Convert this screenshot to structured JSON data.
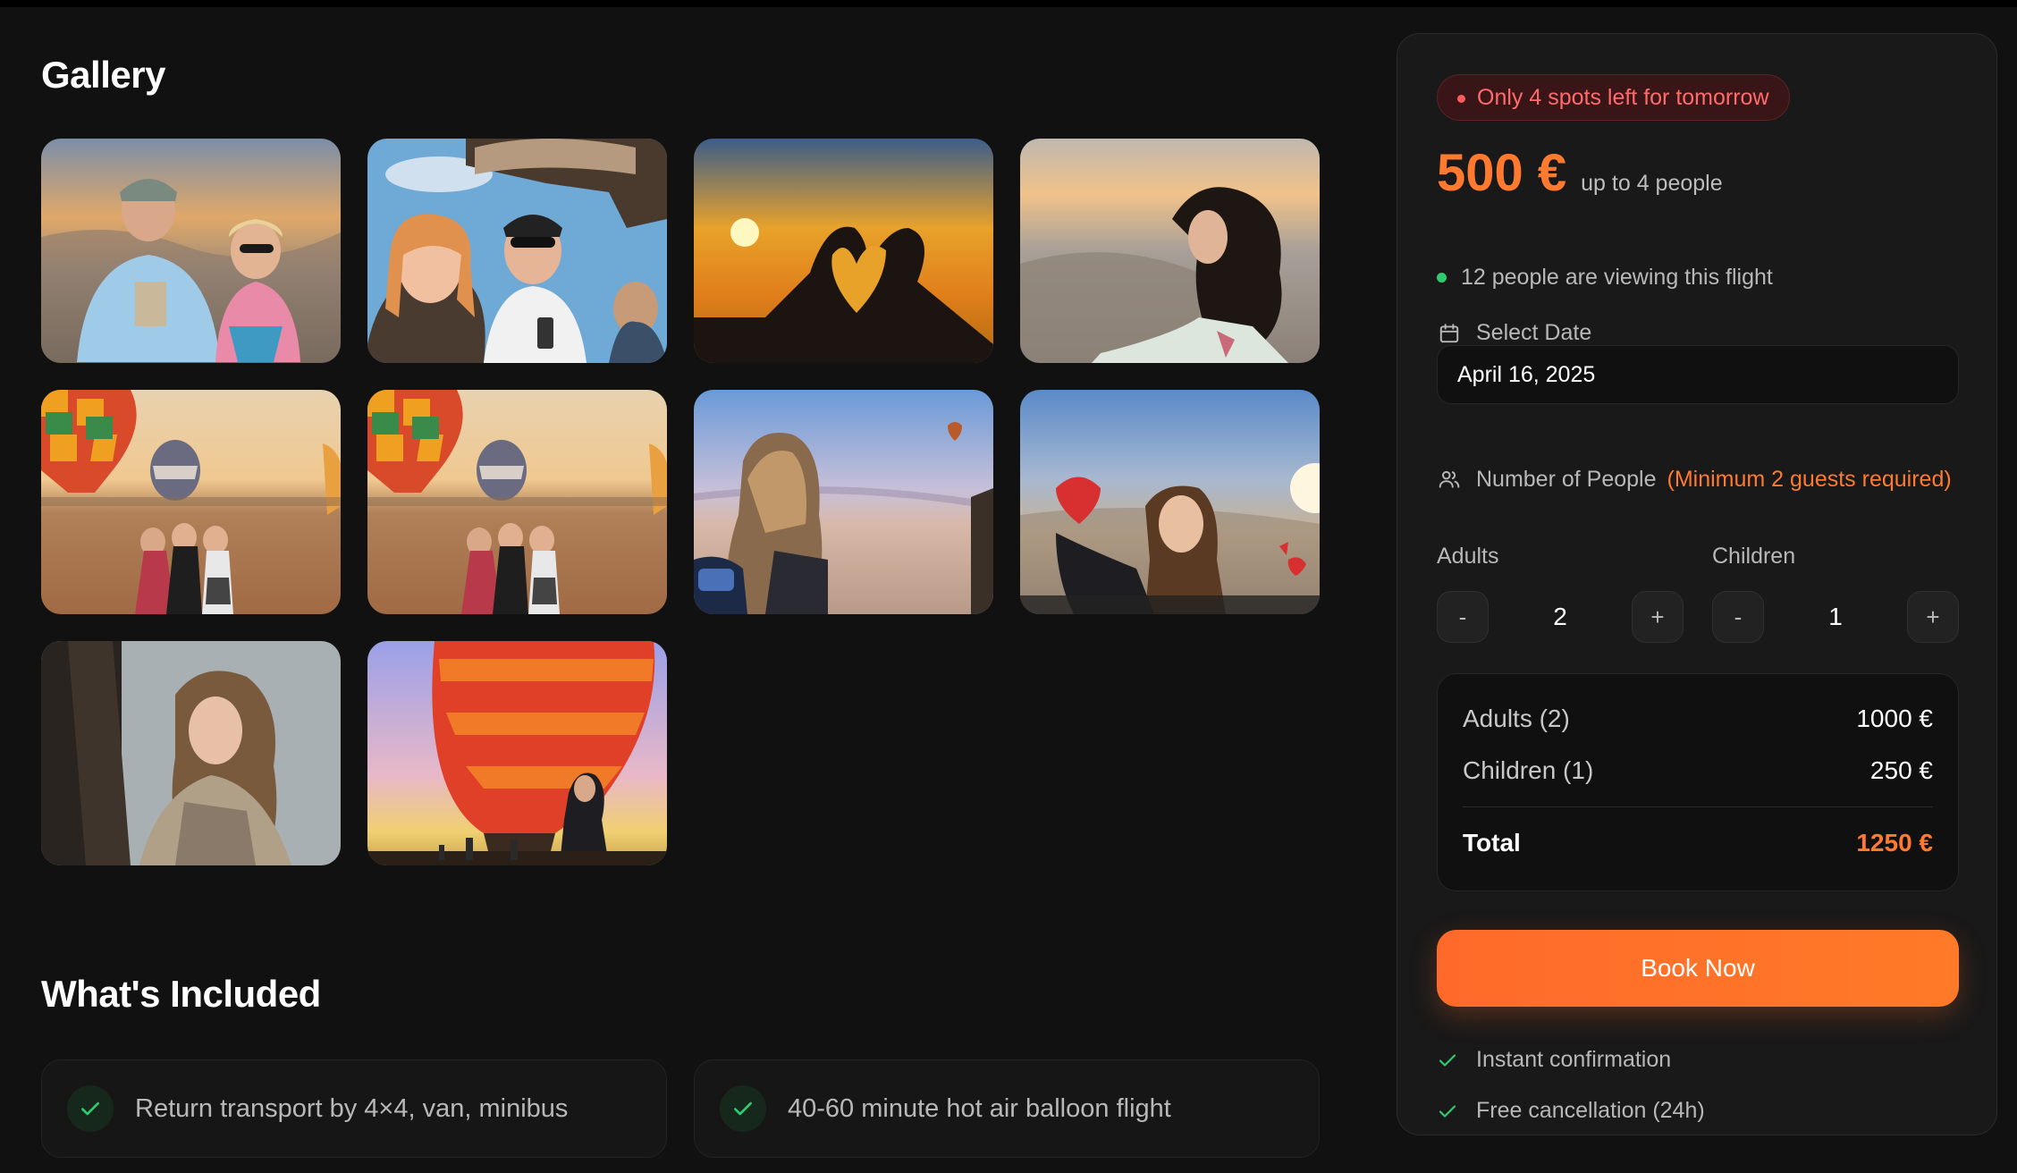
{
  "gallery": {
    "title": "Gallery",
    "photos": [
      {
        "name": "couple-selfie-photo"
      },
      {
        "name": "balloon-basket-selfie-photo"
      },
      {
        "name": "heart-hands-sunset-photo"
      },
      {
        "name": "woman-curly-hair-photo"
      },
      {
        "name": "balloons-group-photo-1"
      },
      {
        "name": "balloons-group-photo-2"
      },
      {
        "name": "woman-desert-view-photo"
      },
      {
        "name": "girl-balloon-photo"
      },
      {
        "name": "woman-basket-portrait-photo"
      },
      {
        "name": "red-balloon-woman-photo"
      }
    ]
  },
  "included": {
    "title": "What's Included",
    "items": [
      {
        "text": "Return transport by 4×4, van, minibus"
      },
      {
        "text": "40-60 minute hot air balloon flight"
      }
    ]
  },
  "booking": {
    "badge": "Only 4 spots left for tomorrow",
    "price": "500 €",
    "price_note": "up to 4 people",
    "viewers": "12 people are viewing this flight",
    "date_label": "Select Date",
    "date_value": "April 16, 2025",
    "people_label": "Number of People",
    "people_min": "(Minimum 2 guests required)",
    "adults_label": "Adults",
    "adults_value": "2",
    "children_label": "Children",
    "children_value": "1",
    "minus": "-",
    "plus": "+",
    "summary": {
      "adults_label": "Adults (2)",
      "adults_price": "1000 €",
      "children_label": "Children (1)",
      "children_price": "250 €",
      "total_label": "Total",
      "total_price": "1250 €"
    },
    "book_label": "Book Now",
    "perks": [
      "Instant confirmation",
      "Free cancellation (24h)"
    ]
  },
  "colors": {
    "accent": "#ff7a2e",
    "success": "#2ecc71",
    "alert": "#ff6b6b"
  }
}
